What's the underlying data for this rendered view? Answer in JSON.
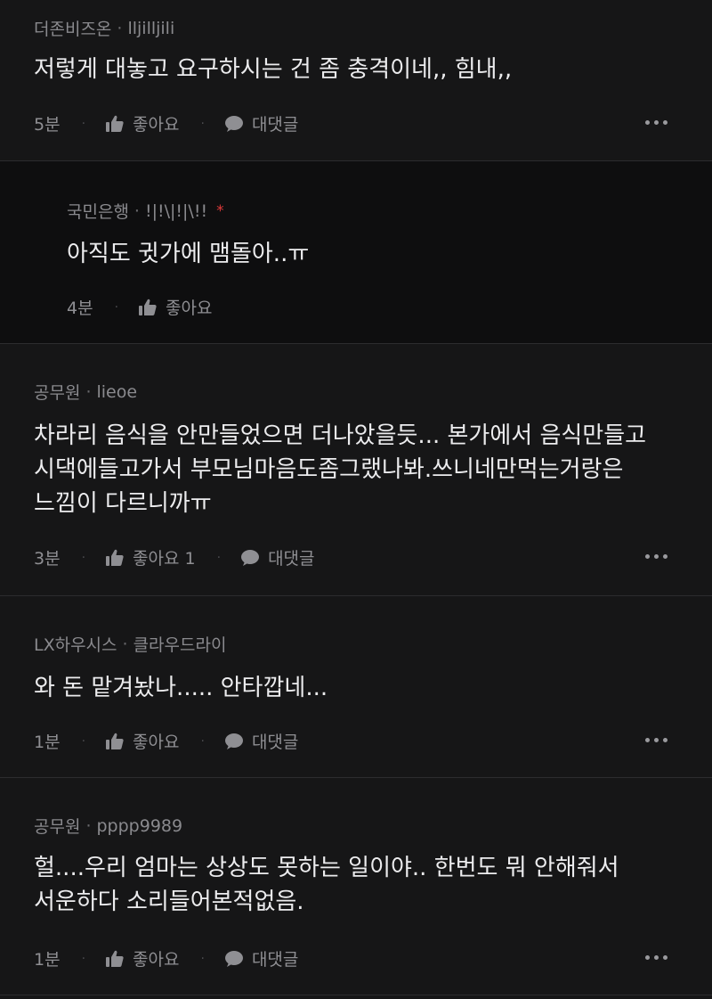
{
  "separator": "·",
  "comments": [
    {
      "company": "더존비즈온",
      "username": "lljilljili",
      "text": "저렇게 대놓고 요구하시는 건 좀 충격이네,, 힘내,,",
      "time": "5분",
      "like_label": "좋아요",
      "reply_label": "대댓글",
      "more_icon": "more-icon"
    },
    {
      "company": "국민은행",
      "username": "!|!\\|!|\\!!",
      "author_mark": "*",
      "text": "아직도 귓가에 맴돌아..ㅠ",
      "time": "4분",
      "like_label": "좋아요"
    },
    {
      "company": "공무원",
      "username": "lieoe",
      "text": "차라리 음식을 안만들었으면 더나았을듯... 본가에서 음식만들고 시댁에들고가서 부모님마음도좀그랬나봐.쓰니네만먹는거랑은 느낌이 다르니까ㅠ",
      "time": "3분",
      "like_label": "좋아요 1",
      "reply_label": "대댓글",
      "more_icon": "more-icon"
    },
    {
      "company": "LX하우시스",
      "username": "클라우드라이",
      "text": "와 돈 맡겨놨나..... 안타깝네...",
      "time": "1분",
      "like_label": "좋아요",
      "reply_label": "대댓글",
      "more_icon": "more-icon"
    },
    {
      "company": "공무원",
      "username": "pppp9989",
      "text": "헐....우리 엄마는 상상도 못하는 일이야.. 한번도 뭐 안해줘서 서운하다 소리들어본적없음.",
      "time": "1분",
      "like_label": "좋아요",
      "reply_label": "대댓글",
      "more_icon": "more-icon"
    }
  ],
  "colors": {
    "background": "#161617",
    "reply_background": "#0e0e0f",
    "text": "#ececee",
    "meta": "#8a8a8e",
    "author_mark": "#e03a3a"
  }
}
